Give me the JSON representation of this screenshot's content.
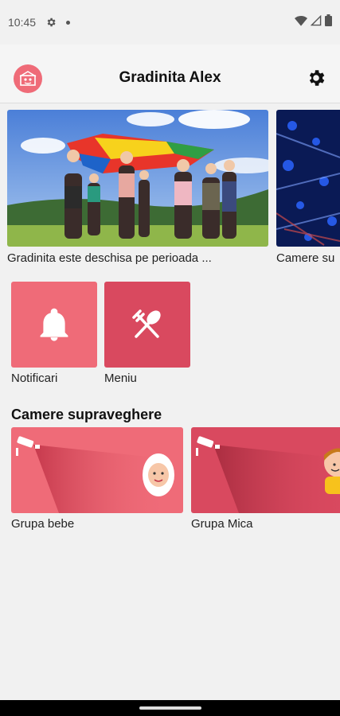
{
  "status_bar": {
    "time": "10:45",
    "icons": [
      "gear-icon",
      "dot-icon",
      "wifi-icon",
      "cellular-icon",
      "battery-icon"
    ]
  },
  "app_bar": {
    "title": "Gradinita Alex",
    "logo_icon": "kindergarten-logo-icon",
    "settings_icon": "gear-icon"
  },
  "news": [
    {
      "caption": "Gradinita este deschisa pe perioada ..."
    },
    {
      "caption": "Camere su"
    }
  ],
  "tiles": [
    {
      "label": "Notificari",
      "icon": "bell-icon",
      "color": "#ef6b78"
    },
    {
      "label": "Meniu",
      "icon": "fork-spoon-icon",
      "color": "#d9495f"
    }
  ],
  "cameras": {
    "title": "Camere supraveghere",
    "items": [
      {
        "label": "Grupa bebe",
        "color": "#ef6b78"
      },
      {
        "label": "Grupa Mica",
        "color": "#d9495f"
      }
    ]
  },
  "colors": {
    "accent": "#ef6b78",
    "accent_dark": "#d9495f",
    "background": "#f1f1f1"
  }
}
